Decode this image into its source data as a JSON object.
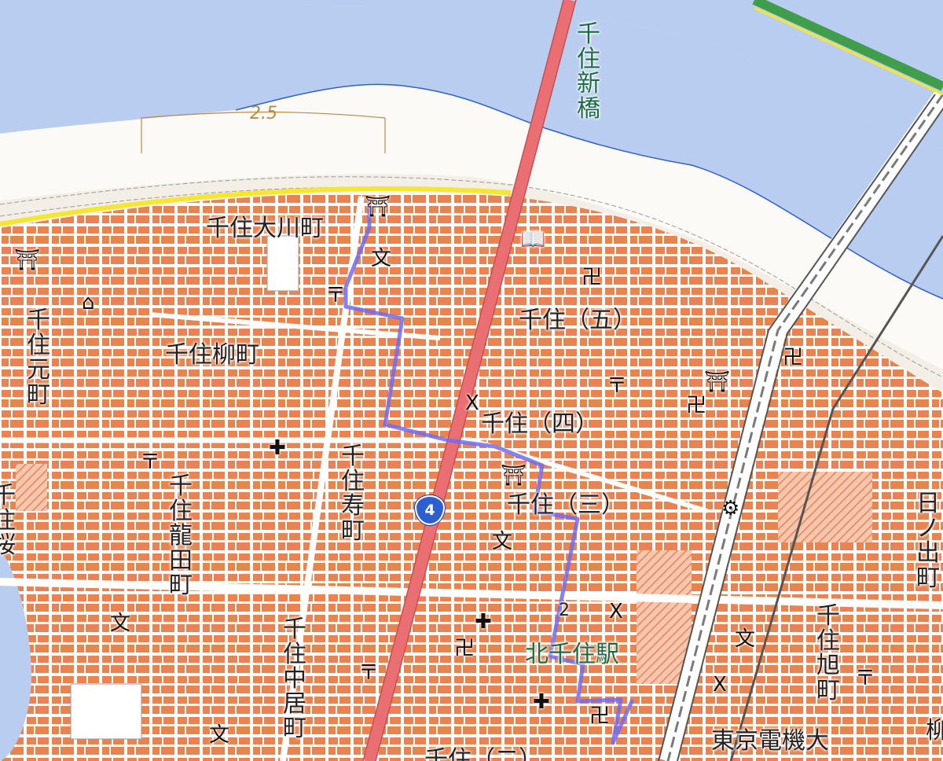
{
  "map": {
    "colors": {
      "water": "#b9cdf0",
      "river_shore": "#2f5fd0",
      "block": "#e98452",
      "road": "#ffffff",
      "rail": "#7a7a7a",
      "yellow_road": "#f5e630",
      "highway": "#e96f72",
      "route": "#6e6cf2",
      "green_rail": "#3f9d4c"
    },
    "labels": {
      "senju_ohashi_label": "千住新橋",
      "contour": "2.5",
      "okawacho": "千住大川町",
      "yanagicho": "千住柳町",
      "motomachi": "千住元町",
      "five": "千住（五）",
      "four": "千住（四）",
      "three": "千住（三）",
      "kotobukicho": "千住寿町",
      "ryudencho": "千住龍田町",
      "nakaicho": "千住中居町",
      "kitasenju_station": "北千住駅",
      "asahicho": "千住旭町",
      "hinodecho": "日ノ出町",
      "denki_univ": "東京電機大",
      "point_2": "2",
      "route_number": "4",
      "edge_left": "千住桜",
      "edge_bottom": "千住（二）",
      "edge_right": "柳"
    },
    "symbols": {
      "shrine": "⛩",
      "temple": "卍",
      "school": "文",
      "post_office": "〒",
      "police": "X",
      "hospital": "✚",
      "library": "📖",
      "factory": "⚙",
      "rest": "⌂"
    }
  }
}
